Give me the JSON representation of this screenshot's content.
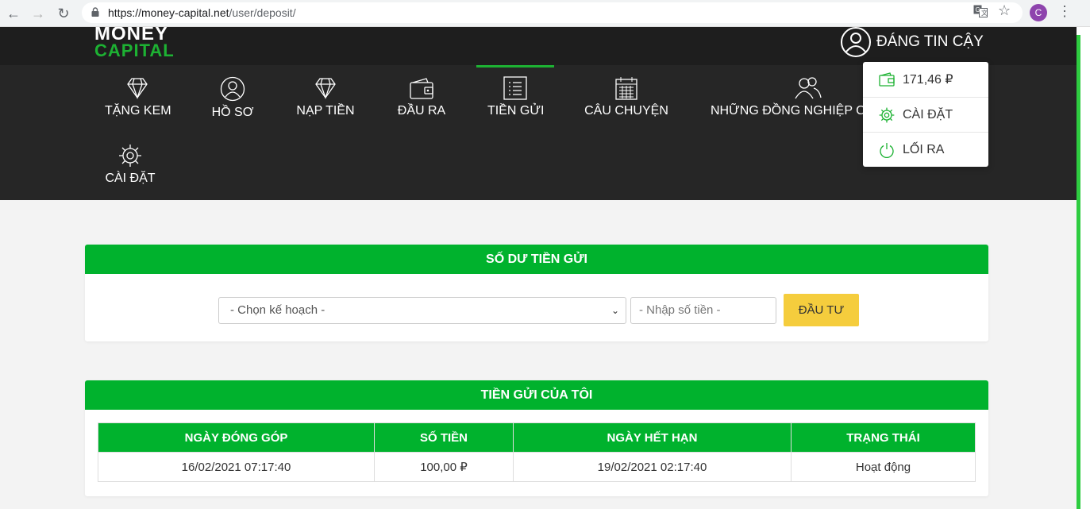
{
  "browser": {
    "url_host": "https://money-capital.net",
    "url_path": "/user/deposit/",
    "profile_initial": "C"
  },
  "header": {
    "logo_line1": "MONEY",
    "logo_line2": "CAPITAL",
    "user_name": "ĐÁNG TIN CẬY"
  },
  "nav": {
    "items": [
      {
        "label": "TẶNG KEM",
        "icon": "diamond-icon"
      },
      {
        "label": "HỒ SƠ",
        "icon": "user-icon"
      },
      {
        "label": "NẠP TIỀN",
        "icon": "diamond-icon"
      },
      {
        "label": "ĐẦU RA",
        "icon": "wallet-icon"
      },
      {
        "label": "TIỀN GỬI",
        "icon": "list-icon"
      },
      {
        "label": "CÂU CHUYỆN",
        "icon": "calendar-icon"
      },
      {
        "label": "NHỮNG ĐỒNG NGHIỆP C",
        "icon": "users-icon"
      },
      {
        "label": "CÀI ĐẶT",
        "icon": "gear-icon"
      }
    ],
    "active_index": 4
  },
  "dropdown": {
    "balance": "171,46 ₽",
    "settings": "CÀI ĐẶT",
    "logout": "LỐI RA"
  },
  "deposit_balance": {
    "title": "SỐ DƯ TIỀN GỬI",
    "plan_select_value": "- Chọn kế hoạch -",
    "amount_placeholder": "- Nhập số tiền -",
    "invest_button": "ĐẦU TƯ"
  },
  "my_deposits": {
    "title": "TIỀN GỬI CỦA TÔI",
    "columns": [
      "NGÀY ĐÓNG GÓP",
      "SỐ TIỀN",
      "NGÀY HẾT HẠN",
      "TRẠNG THÁI"
    ],
    "rows": [
      [
        "16/02/2021 07:17:40",
        "100,00 ₽",
        "19/02/2021 02:17:40",
        "Hoạt động"
      ]
    ]
  },
  "colors": {
    "brand_green": "#00b22d",
    "invest_yellow": "#f5cd3d",
    "nav_dark": "#262626"
  }
}
